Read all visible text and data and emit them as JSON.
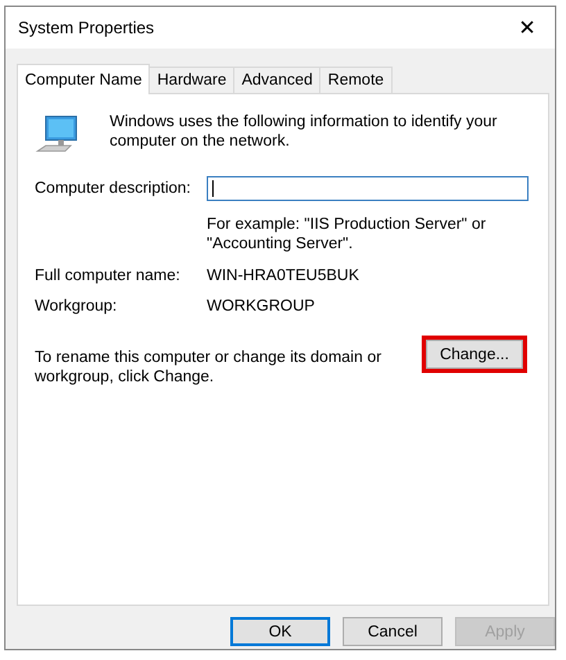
{
  "window": {
    "title": "System Properties",
    "close": "✕"
  },
  "tabs": [
    {
      "label": "Computer Name",
      "selected": true
    },
    {
      "label": "Hardware",
      "selected": false
    },
    {
      "label": "Advanced",
      "selected": false
    },
    {
      "label": "Remote",
      "selected": false
    }
  ],
  "intro": "Windows uses the following information to identify your computer on the network.",
  "description": {
    "label": "Computer description:",
    "hint": "For example: \"IIS Production Server\" or \"Accounting Server\"."
  },
  "fields": [
    {
      "label": "Full computer name:",
      "value": "WIN-HRA0TEU5BUK"
    },
    {
      "label": "Workgroup:",
      "value": "WORKGROUP"
    }
  ],
  "rename": {
    "text": "To rename this computer or change its domain or workgroup, click Change.",
    "button": "Change...",
    "highlighted": true
  },
  "buttons": [
    {
      "label": "OK",
      "default": true,
      "disabled": false
    },
    {
      "label": "Cancel",
      "default": false,
      "disabled": false
    },
    {
      "label": "Apply",
      "default": false,
      "disabled": true
    }
  ]
}
